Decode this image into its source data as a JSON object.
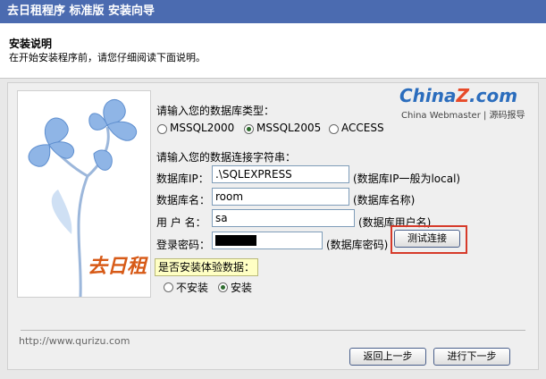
{
  "window": {
    "title": "去日租程序 标准版 安装向导"
  },
  "header": {
    "title": "安装说明",
    "subtitle": "在开始安装程序前，请您仔细阅读下面说明。"
  },
  "logo": {
    "text_china": "China",
    "text_z": "Z",
    "text_com": ".com",
    "sub": "China Webmaster | 源码报导"
  },
  "brand": {
    "text": "去日租"
  },
  "db_type": {
    "label": "请输入您的数据库类型：",
    "options": [
      "MSSQL2000",
      "MSSQL2005",
      "ACCESS"
    ],
    "selected": "MSSQL2005"
  },
  "connection": {
    "section_label": "请输入您的数据连接字符串：",
    "server_label": "数据库IP：",
    "server_value": ".\\SQLEXPRESS",
    "server_hint": "(数据库IP一般为local)",
    "dbname_label": "数据库名：",
    "dbname_value": "room",
    "dbname_hint": "(数据库名称)",
    "user_label": "用 户 名：",
    "user_value": "sa",
    "user_hint": "(数据库用户名)",
    "password_label": "登录密码：",
    "password_hint": "(数据库密码)",
    "test_button": "测试连接"
  },
  "trial": {
    "question": "是否安装体验数据：",
    "options": [
      "不安装",
      "安装"
    ],
    "selected": "安装"
  },
  "footer": {
    "url": "http://www.qurizu.com"
  },
  "nav": {
    "back": "返回上一步",
    "next": "进行下一步"
  },
  "colors": {
    "titlebar": "#4b6bb0",
    "highlight": "#d63a2a",
    "hint_bg": "#ffffc4"
  }
}
